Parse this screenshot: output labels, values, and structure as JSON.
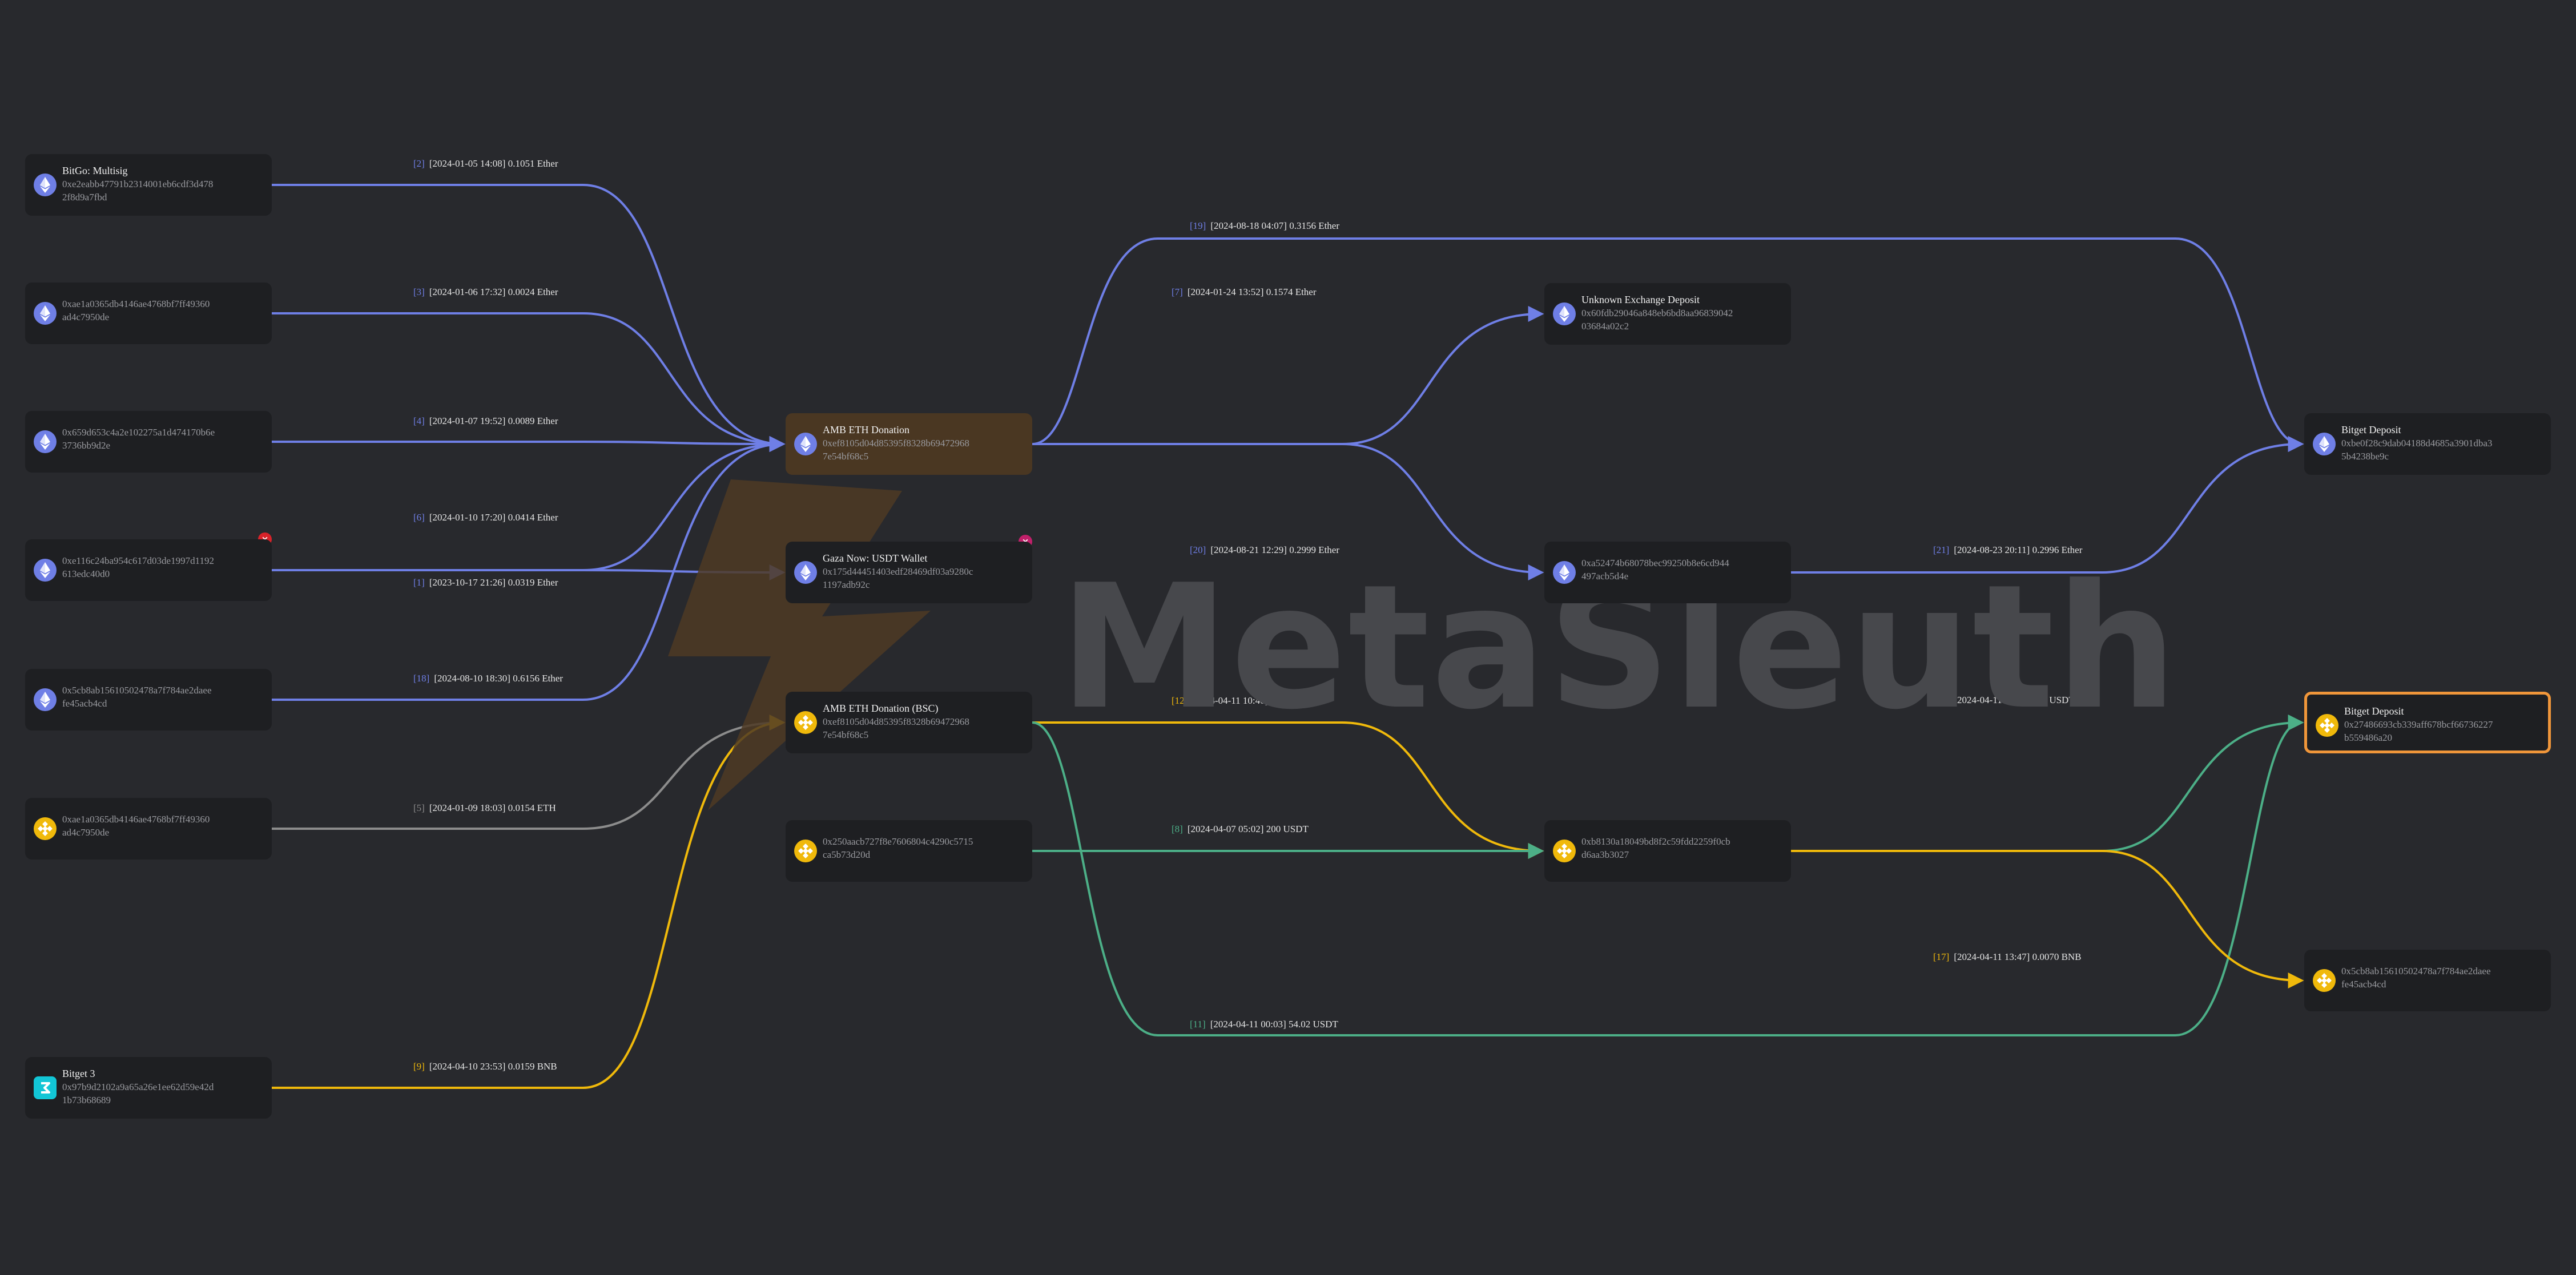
{
  "watermark": "MetaSleuth",
  "colors": {
    "background": "#28292d",
    "node": "#1e1f22",
    "eth_edge": "#6f7fe6",
    "bnb_edge": "#f0b90b",
    "usdt_edge": "#4caf87",
    "eth_edge_gray": "#8c8c8c",
    "selected_border": "#f0963a",
    "highlight_node": "#4a3722"
  },
  "nodes": [
    {
      "id": "bitgo",
      "label": "BitGo: Multisig",
      "address": [
        "0xe2eabb47791b2314001eb6cdf3d478",
        "2f8d9a7fbd"
      ],
      "icon": "ethereum-icon"
    },
    {
      "id": "n_aae1_eth",
      "label": "",
      "address": [
        "0xae1a0365db4146ae4768bf7ff49360",
        "ad4c7950de"
      ],
      "icon": "ethereum-icon"
    },
    {
      "id": "n_a659",
      "label": "",
      "address": [
        "0x659d653c4a2e102275a1d474170b6e",
        "3736bb9d2e"
      ],
      "icon": "ethereum-icon"
    },
    {
      "id": "n_e116",
      "label": "",
      "address": [
        "0xe116c24ba954c617d03de1997d1192",
        "613edc40d0"
      ],
      "icon": "ethereum-icon",
      "badge": "×"
    },
    {
      "id": "n_5cb8_eth",
      "label": "",
      "address": [
        "0x5cb8ab15610502478a7f784ae2daee",
        "fe45acb4cd"
      ],
      "icon": "ethereum-icon"
    },
    {
      "id": "n_aae1_bnb",
      "label": "",
      "address": [
        "0xae1a0365db4146ae4768bf7ff49360",
        "ad4c7950de"
      ],
      "icon": "bnb-icon"
    },
    {
      "id": "bitget3",
      "label": "Bitget 3",
      "address": [
        "0x97b9d2102a9a65a26e1ee62d59e42d",
        "1b73b68689"
      ],
      "icon": "bitget-icon"
    },
    {
      "id": "amb_eth",
      "label": "AMB ETH Donation",
      "address": [
        "0xef8105d04d85395f8328b69472968",
        "7e54bf68c5"
      ],
      "icon": "ethereum-icon"
    },
    {
      "id": "gaza",
      "label": "Gaza Now: USDT Wallet",
      "address": [
        "0x175d44451403edf28469df03a9280c",
        "1197adb92c"
      ],
      "icon": "ethereum-icon",
      "badge": "×"
    },
    {
      "id": "amb_bsc",
      "label": "AMB ETH Donation (BSC)",
      "address": [
        "0xef8105d04d85395f8328b69472968",
        "7e54bf68c5"
      ],
      "icon": "bnb-icon"
    },
    {
      "id": "n_250a",
      "label": "",
      "address": [
        "0x250aacb727f8e7606804c4290c5715",
        "ca5b73d20d"
      ],
      "icon": "bnb-icon"
    },
    {
      "id": "unknown_ex",
      "label": "Unknown Exchange Deposit",
      "address": [
        "0x60fdb29046a848eb6bd8aa96839042",
        "03684a02c2"
      ],
      "icon": "ethereum-icon"
    },
    {
      "id": "n_a524",
      "label": "",
      "address": [
        "0xa52474b68078bec99250b8e6cd944",
        "497acb5d4e"
      ],
      "icon": "ethereum-icon"
    },
    {
      "id": "n_b813",
      "label": "",
      "address": [
        "0xb8130a18049bd8f2c59fdd2259f0cb",
        "d6aa3b3027"
      ],
      "icon": "bnb-icon"
    },
    {
      "id": "bitget_dep_eth",
      "label": "Bitget Deposit",
      "address": [
        "0xbe0f28c9dab04188d4685a3901dba3",
        "5b4238be9c"
      ],
      "icon": "ethereum-icon"
    },
    {
      "id": "bitget_dep_bnb",
      "label": "Bitget Deposit",
      "address": [
        "0x27486693cb339aff678bcf66736227",
        "b559486a20"
      ],
      "icon": "bnb-icon"
    },
    {
      "id": "n_5cb8_bnb",
      "label": "",
      "address": [
        "0x5cb8ab15610502478a7f784ae2daee",
        "fe45acb4cd"
      ],
      "icon": "bnb-icon"
    }
  ],
  "edges": [
    {
      "from": "bitgo",
      "to": "amb_eth",
      "index": "[2]",
      "text": "[2024-01-05 14:08] 0.1051 Ether",
      "color": "eth"
    },
    {
      "from": "n_aae1_eth",
      "to": "amb_eth",
      "index": "[3]",
      "text": "[2024-01-06 17:32] 0.0024 Ether",
      "color": "eth"
    },
    {
      "from": "n_a659",
      "to": "amb_eth",
      "index": "[4]",
      "text": "[2024-01-07 19:52] 0.0089 Ether",
      "color": "eth"
    },
    {
      "from": "n_e116",
      "to": "amb_eth",
      "index": "[6]",
      "text": "[2024-01-10 17:20] 0.0414 Ether",
      "color": "eth"
    },
    {
      "from": "n_e116",
      "to": "gaza",
      "index": "[1]",
      "text": "[2023-10-17 21:26] 0.0319 Ether",
      "color": "eth"
    },
    {
      "from": "n_5cb8_eth",
      "to": "amb_eth",
      "index": "[18]",
      "text": "[2024-08-10 18:30] 0.6156 Ether",
      "color": "eth"
    },
    {
      "from": "n_aae1_bnb",
      "to": "amb_bsc",
      "index": "[5]",
      "text": "[2024-01-09 18:03] 0.0154 ETH",
      "color": "gray"
    },
    {
      "from": "bitget3",
      "to": "amb_bsc",
      "index": "[9]",
      "text": "[2024-04-10 23:53] 0.0159 BNB",
      "color": "bnb"
    },
    {
      "from": "amb_eth",
      "to": "bitget_dep_eth",
      "index": "[19]",
      "text": "[2024-08-18 04:07] 0.3156 Ether",
      "color": "eth"
    },
    {
      "from": "amb_eth",
      "to": "unknown_ex",
      "index": "[7]",
      "text": "[2024-01-24 13:52] 0.1574 Ether",
      "color": "eth"
    },
    {
      "from": "amb_eth",
      "to": "n_a524",
      "index": "[20]",
      "text": "[2024-08-21 12:29] 0.2999 Ether",
      "color": "eth"
    },
    {
      "from": "n_a524",
      "to": "bitget_dep_eth",
      "index": "[21]",
      "text": "[2024-08-23 20:11] 0.2996 Ether",
      "color": "eth"
    },
    {
      "from": "amb_bsc",
      "to": "n_b813",
      "index": "[12]",
      "text": "[2024-04-11 10:40] 0.0155 BNB",
      "color": "bnb"
    },
    {
      "from": "n_250a",
      "to": "n_b813",
      "index": "[8]",
      "text": "[2024-04-07 05:02] 200 USDT",
      "color": "usdt"
    },
    {
      "from": "amb_bsc",
      "to": "bitget_dep_bnb",
      "index": "[11]",
      "text": "[2024-04-11 00:03] 54.02 USDT",
      "color": "usdt"
    },
    {
      "from": "n_b813",
      "to": "bitget_dep_bnb",
      "index": "[13]",
      "text": "[2024-04-11 10:44] 200 USDT",
      "color": "usdt"
    },
    {
      "from": "n_b813",
      "to": "n_5cb8_bnb",
      "index": "[17]",
      "text": "[2024-04-11 13:47] 0.0070 BNB",
      "color": "bnb"
    }
  ]
}
